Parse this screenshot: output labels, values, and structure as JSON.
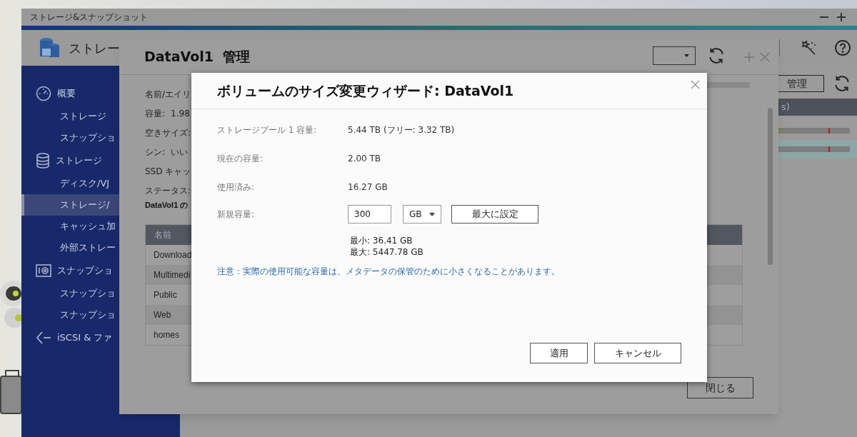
{
  "app": {
    "title": "ストレージ&スナップショット",
    "header_title": "ストレー",
    "manage_button": "管理",
    "table_header_fragment": "s)",
    "meter_rows": [
      {
        "level": 0.02,
        "selected": false
      },
      {
        "level": 0,
        "selected": true
      }
    ]
  },
  "sidebar": {
    "groups": [
      {
        "label": "概要",
        "kind": "gauge",
        "items": [
          {
            "label": "ストレージ",
            "selected": false
          },
          {
            "label": "スナップショ",
            "selected": false
          }
        ]
      },
      {
        "label": "ストレージ",
        "kind": "database",
        "items": [
          {
            "label": "ディスク/VJ",
            "selected": false
          },
          {
            "label": "ストレージ/",
            "selected": true
          },
          {
            "label": "キャッシュ加",
            "selected": false
          },
          {
            "label": "外部ストレー",
            "selected": false
          }
        ]
      },
      {
        "label": "スナップショ",
        "kind": "camera",
        "items": [
          {
            "label": "スナップショ",
            "selected": false
          },
          {
            "label": "スナップショ",
            "selected": false
          }
        ]
      },
      {
        "label": "iSCSI & ファ",
        "kind": "arrow"
      }
    ]
  },
  "manage_dialog": {
    "title": "DataVol1  管理",
    "fields": [
      {
        "label": "名前/エイリ"
      },
      {
        "label": "容量:",
        "value": "1.98"
      },
      {
        "label": "空きサイズ:"
      },
      {
        "label": "シン:",
        "value": "いい"
      },
      {
        "label": "SSD キャッ"
      },
      {
        "label": "ステータス:"
      }
    ],
    "section_title": "DataVol1 の",
    "table": {
      "columns": [
        "名前"
      ],
      "rows": [
        "Download",
        "Multimedi",
        "Public",
        "Web",
        "homes"
      ]
    },
    "close_button": "閉じる"
  },
  "wizard": {
    "title": "ボリュームのサイズ変更ウィザード: DataVol1",
    "rows": [
      {
        "label": "ストレージプール 1 容量:",
        "value": "5.44 TB (フリー: 3.32 TB)"
      },
      {
        "label": "現在の容量:",
        "value": "2.00 TB"
      },
      {
        "label": "使用済み:",
        "value": "16.27 GB"
      }
    ],
    "new_capacity": {
      "label": "新規容量:",
      "value": "300",
      "unit": "GB",
      "max_button": "最大に設定"
    },
    "min": "最小: 36.41 GB",
    "max": "最大: 5447.78 GB",
    "note": "注意：実際の使用可能な容量は、メタデータの保管のために小さくなることがあります。",
    "buttons": [
      "適用",
      "キャンセル"
    ]
  }
}
